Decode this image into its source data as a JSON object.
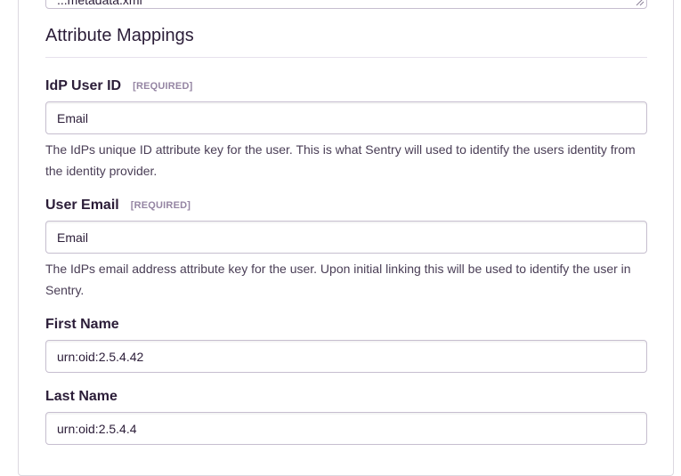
{
  "metadata_textarea": {
    "clipped_value": "...metadata.xml"
  },
  "section": {
    "title": "Attribute Mappings"
  },
  "fields": [
    {
      "label": "IdP User ID",
      "required": "[REQUIRED]",
      "value": "Email",
      "help": "The IdPs unique ID attribute key for the user. This is what Sentry will used to identify the users identity from the identity provider."
    },
    {
      "label": "User Email",
      "required": "[REQUIRED]",
      "value": "Email",
      "help": "The IdPs email address attribute key for the user. Upon initial linking this will be used to identify the user in Sentry."
    },
    {
      "label": "First Name",
      "value": "urn:oid:2.5.4.42"
    },
    {
      "label": "Last Name",
      "value": "urn:oid:2.5.4.4"
    }
  ],
  "colors": {
    "text": "#2b1d38",
    "muted": "#9585a3",
    "border": "#c6becf"
  }
}
